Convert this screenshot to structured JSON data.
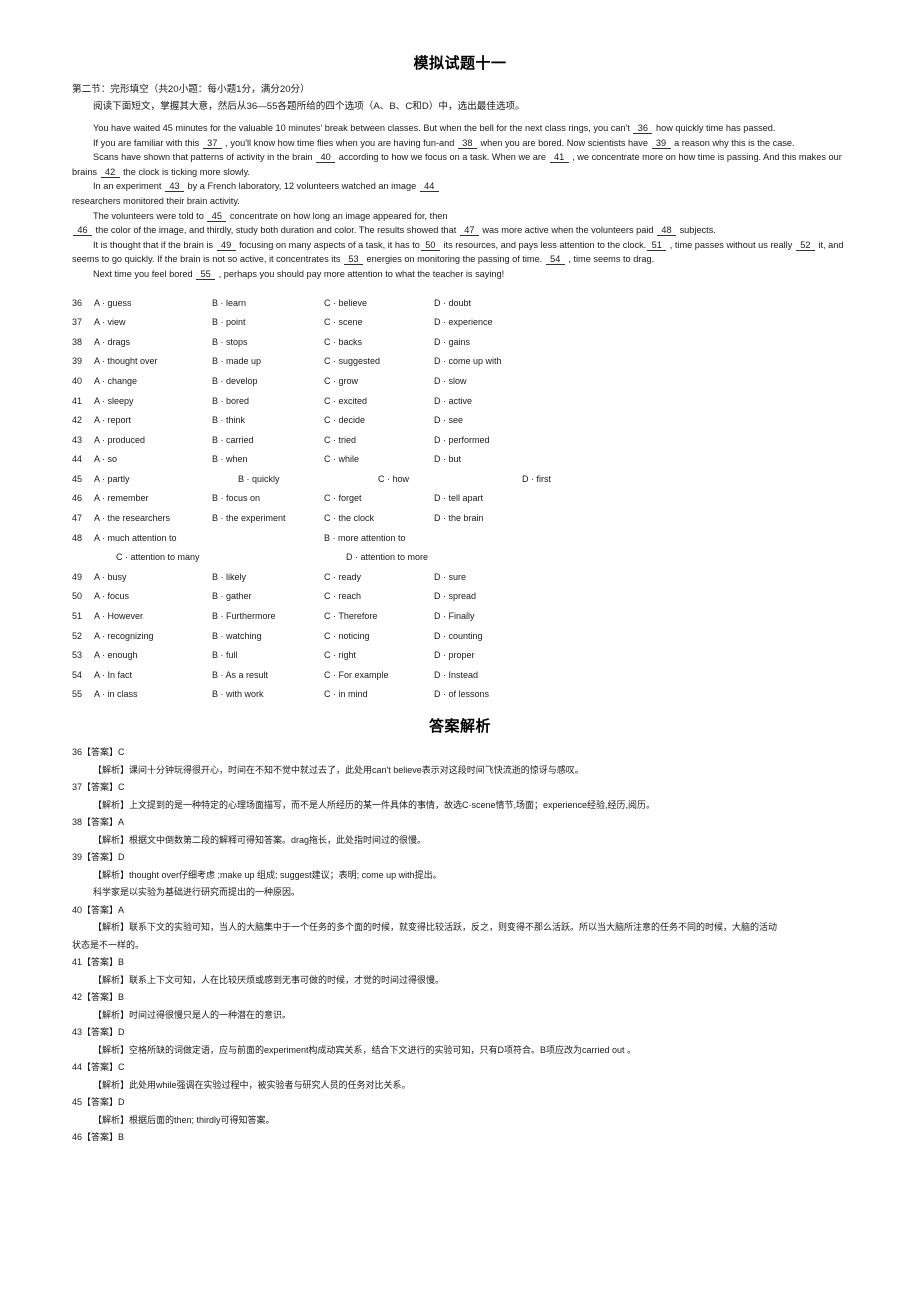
{
  "document": {
    "title": "模拟试题十一",
    "answer_section_title": "答案解析",
    "section_heading": "第二节：完形填空（共20小题：每小题1分，满分20分）",
    "instruction": "阅读下面短文，掌握其大意，然后从36—55各题所给的四个选项（A、B、C和D）中，选出最佳选项。"
  },
  "passage": {
    "p1_a": "You have waited 45 minutes for the valuable 10 minutes' break between classes. But when the bell for the next class rings, you can't ",
    "p1_blank": "36",
    "p1_b": " how quickly time has passed.",
    "p2_a": "If you are familiar with this ",
    "p2_blank1": "37",
    "p2_b": " , you'll know how time flies when you are having fun-and ",
    "p2_blank2": "38",
    "p2_c": " when you are bored. Now scientists have ",
    "p2_blank3": "39",
    "p2_d": " a reason why this is the case.",
    "p3_a": "Scans have shown that patterns of activity in the brain ",
    "p3_blank1": "40",
    "p3_b": " according to how we focus on a task. When we are ",
    "p3_blank2": "41",
    "p3_c": " , we concentrate more on how time is passing. And this makes our",
    "p3_d": "brains ",
    "p3_blank3": "42",
    "p3_e": " the clock is ticking more slowly.",
    "p4_a": "In an experiment ",
    "p4_blank1": "43",
    "p4_b": " by a French laboratory, 12 volunteers watched an image ",
    "p4_blank2": "44",
    "p4_c": "researchers monitored their brain activity.",
    "p5_a": "The volunteers were told to ",
    "p5_blank1": "45",
    "p5_b": " concentrate on how long an image appeared for, then",
    "p5_blank2": "46",
    "p5_c": " the color of the image, and thirdly, study both duration and color. The results showed that ",
    "p5_blank3": "47",
    "p5_d": " was more active when the volunteers paid ",
    "p5_blank4": "48",
    "p5_e": " subjects.",
    "p6_a": "It is thought that if the brain is ",
    "p6_blank1": "49",
    "p6_b": " focusing on many aspects of a task, it has to",
    "p6_blank2": "50",
    "p6_c": " its resources, and pays less attention to the clock.",
    "p6_blank3": "51",
    "p6_d": " , time passes without us really ",
    "p6_blank4": "52",
    "p6_e": " it, and",
    "p6_f": "seems to go quickly. If the brain is not so active, it concentrates its ",
    "p6_blank5": "53",
    "p6_g": " energies on monitoring the passing of time. ",
    "p6_blank6": "54",
    "p6_h": " , time seems to drag.",
    "p7_a": "Next time you feel bored ",
    "p7_blank1": "55",
    "p7_b": " , perhaps you should pay more attention to what the teacher is saying!"
  },
  "options": [
    {
      "num": "36",
      "a": "A · guess",
      "b": "B · learn",
      "c": "C · believe",
      "d": "D · doubt"
    },
    {
      "num": "37",
      "a": "A · view",
      "b": "B · point",
      "c": "C · scene",
      "d": "D · experience"
    },
    {
      "num": "38",
      "a": "A · drags",
      "b": "B · stops",
      "c": "C · backs",
      "d": "D · gains"
    },
    {
      "num": "39",
      "a": "A · thought over",
      "b": "B · made up",
      "c": "C · suggested",
      "d": "D · come up with"
    },
    {
      "num": "40",
      "a": "A · change",
      "b": "B · develop",
      "c": "C · grow",
      "d": "D · slow"
    },
    {
      "num": "41",
      "a": "A · sleepy",
      "b": "B · bored",
      "c": "C · excited",
      "d": "D · active"
    },
    {
      "num": "42",
      "a": "A · report",
      "b": "B · think",
      "c": "C · decide",
      "d": "D · see"
    },
    {
      "num": "43",
      "a": "A · produced",
      "b": "B · carried",
      "c": "C · tried",
      "d": "D · performed"
    },
    {
      "num": "44",
      "a": "A · so",
      "b": "B · when",
      "c": "C · while",
      "d": "D · but"
    },
    {
      "num": "45",
      "a": "A · partly",
      "b": "B · quickly",
      "c": "C · how",
      "d": "D · first",
      "wide": true
    },
    {
      "num": "46",
      "a": "A · remember",
      "b": "B · focus on",
      "c": "C · forget",
      "d": "D · tell apart"
    },
    {
      "num": "47",
      "a": "A · the researchers",
      "b": "B · the experiment",
      "c": "C · the clock",
      "d": "D · the brain"
    }
  ],
  "option48": {
    "num": "48",
    "a": "A · much attention to",
    "b": "B · more attention to",
    "c": "C · attention to many",
    "d": "D · attention to more"
  },
  "options_tail": [
    {
      "num": "49",
      "a": "A · busy",
      "b": "B · likely",
      "c": "C · ready",
      "d": "D · sure"
    },
    {
      "num": "50",
      "a": "A · focus",
      "b": "B · gather",
      "c": "C · reach",
      "d": "D · spread"
    },
    {
      "num": "51",
      "a": "A · However",
      "b": "B · Furthermore",
      "c": "C · Therefore",
      "d": "D · Finally"
    },
    {
      "num": "52",
      "a": "A · recognizing",
      "b": "B · watching",
      "c": "C · noticing",
      "d": "D · counting"
    },
    {
      "num": "53",
      "a": "A · enough",
      "b": "B · full",
      "c": "C · right",
      "d": "D · proper"
    },
    {
      "num": "54",
      "a": "A · In fact",
      "b": "B · As a result",
      "c": "C · For example",
      "d": "D · Instead"
    },
    {
      "num": "55",
      "a": "A · in class",
      "b": "B · with work",
      "c": "C · in mind",
      "d": "D · of lessons"
    }
  ],
  "answers": [
    {
      "head": "36【答案】C",
      "body": "【解析】课间十分钟玩得很开心，时间在不知不觉中就过去了，此处用can't believe表示对这段时间飞快流逝的惊讶与感叹。"
    },
    {
      "head": "37【答案】C",
      "body": "【解析】上文提到的是一种特定的心理场面描写，而不是人所经历的某一件具体的事情，故选C·scene情节,场面；experience经验,经历,阅历。"
    },
    {
      "head": "38【答案】A",
      "body": "【解析】根据文中倒数第二段的解释可得知答案。drag拖长，此处指时间过的很慢。"
    },
    {
      "head": "39【答案】D",
      "body": "【解析】thought over仔细考虑 ;make up 组成; suggest建议；表明; come up with提出。",
      "extra": "科学家是以实验为基础进行研究而提出的一种原因。"
    },
    {
      "head": "40【答案】A",
      "body": "【解析】联系下文的实验可知，当人的大脑集中于一个任务的多个面的时候，就变得比较活跃，反之，则变得不那么活跃。所以当大脑所注意的任务不同的时候，大脑的活动",
      "cont": "状态是不一样的。"
    },
    {
      "head": "41【答案】B",
      "body": "【解析】联系上下文可知，人在比较厌烦或感到无事可做的时候，才觉的时间过得很慢。"
    },
    {
      "head": "42【答案】B",
      "body": "【解析】时间过得很慢只是人的一种潜在的意识。"
    },
    {
      "head": "43【答案】D",
      "body": "【解析】空格所缺的词做定语，应与前面的experiment构成动宾关系，结合下文进行的实验可知，只有D项符合。B项应改为carried out 。"
    },
    {
      "head": "44【答案】C",
      "body": "【解析】此处用while强调在实验过程中，被实验者与研究人员的任务对比关系。"
    },
    {
      "head": "45【答案】D",
      "body": "【解析】根据后面的then; thirdly可得知答案。"
    },
    {
      "head": "46【答案】B"
    }
  ]
}
